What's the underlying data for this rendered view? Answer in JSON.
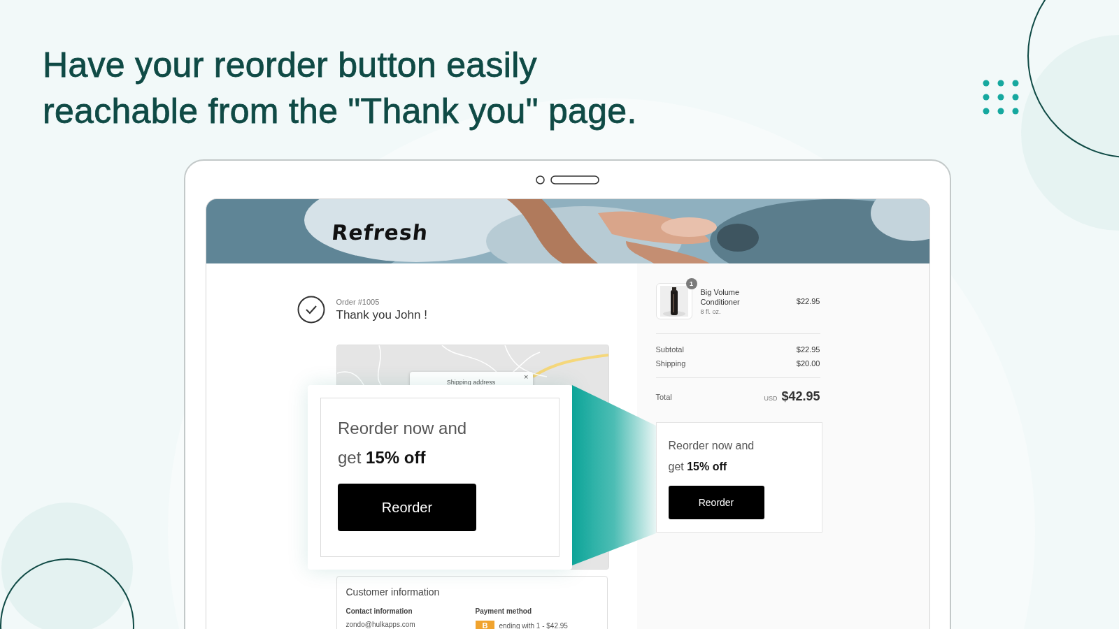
{
  "headline": {
    "lines": [
      "Have your reorder button easily",
      "reachable from the \"Thank you\" page."
    ]
  },
  "store": {
    "logo": "Refresh"
  },
  "order": {
    "number": "Order #1005",
    "greeting": "Thank you John !"
  },
  "map": {
    "kind": "picture",
    "popup": {
      "title": "Shipping address",
      "close": "×"
    }
  },
  "customer_info": {
    "title": "Customer information",
    "contact": {
      "label": "Contact information",
      "email": "zondo@hulkapps.com"
    },
    "payment": {
      "label": "Payment method",
      "card_badge": "B",
      "description": "ending with 1 - $42.95"
    }
  },
  "summary": {
    "items": [
      {
        "name": "Big Volume Conditioner",
        "variant": "8 fl. oz.",
        "quantity": "1",
        "price": "$22.95"
      }
    ],
    "lines": [
      {
        "label": "Subtotal",
        "value": "$22.95"
      },
      {
        "label": "Shipping",
        "value": "$20.00"
      }
    ],
    "total": {
      "label": "Total",
      "currency": "USD",
      "value": "$42.95"
    }
  },
  "reorder_widget": {
    "lines": [
      "Reorder now and",
      "get **15% off**"
    ],
    "button": "Reorder"
  },
  "reorder_popup": {
    "lines": [
      "Reorder now and",
      "get **15% off**"
    ],
    "button": "Reorder"
  }
}
